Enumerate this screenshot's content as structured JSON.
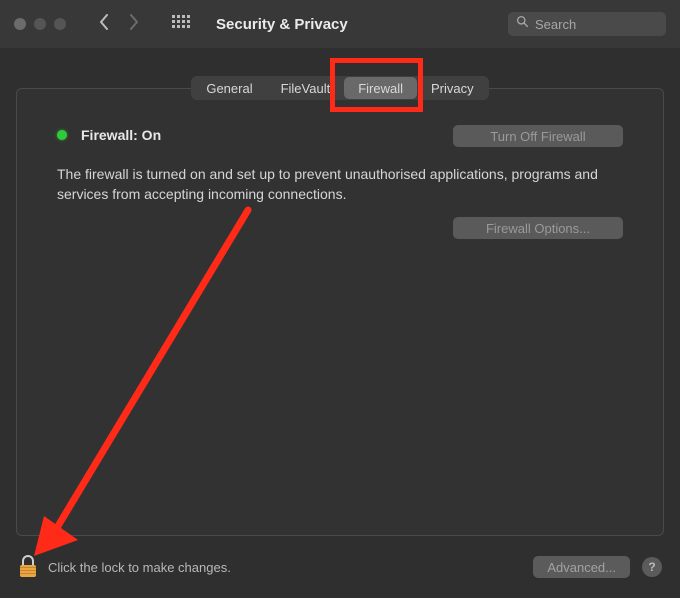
{
  "window": {
    "title": "Security & Privacy",
    "search_placeholder": "Search"
  },
  "tabs": {
    "items": [
      "General",
      "FileVault",
      "Firewall",
      "Privacy"
    ],
    "active_index": 2
  },
  "firewall": {
    "status_label": "Firewall: On",
    "status_on": true,
    "turn_off_label": "Turn Off Firewall",
    "description": "The firewall is turned on and set up to prevent unauthorised applications, programs and services from accepting incoming connections.",
    "options_label": "Firewall Options..."
  },
  "footer": {
    "lock_text": "Click the lock to make changes.",
    "advanced_label": "Advanced...",
    "help_label": "?"
  },
  "annotations": {
    "highlight_tab": "Firewall",
    "arrow_target": "lock-icon"
  }
}
